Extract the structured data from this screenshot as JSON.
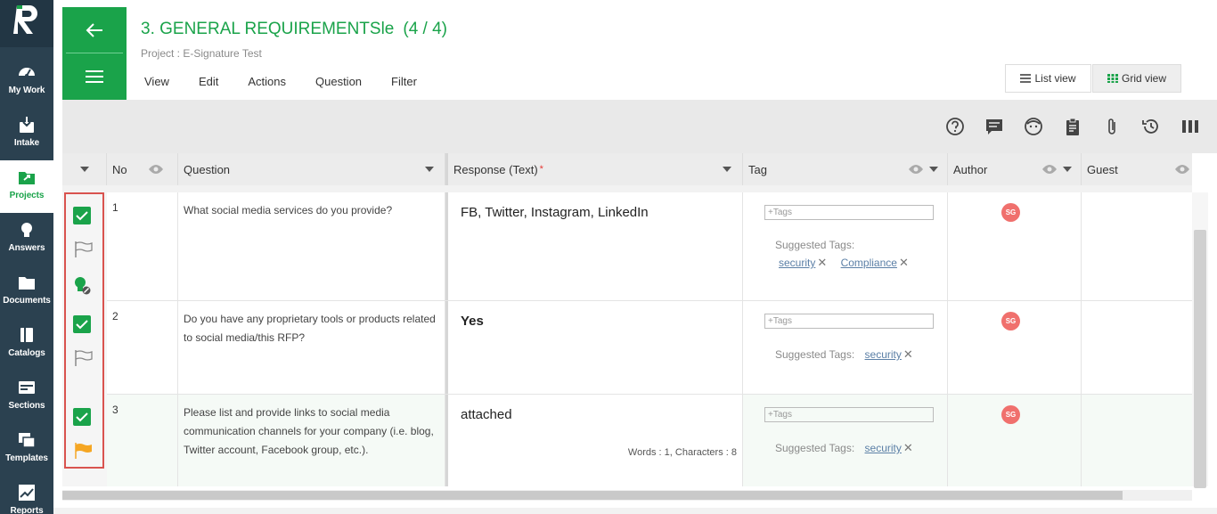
{
  "nav": {
    "items": [
      {
        "label": "My Work",
        "icon": "gauge-icon"
      },
      {
        "label": "Intake",
        "icon": "inbox-download-icon"
      },
      {
        "label": "Projects",
        "icon": "folder-arrow-icon",
        "active": true
      },
      {
        "label": "Answers",
        "icon": "lightbulb-icon"
      },
      {
        "label": "Documents",
        "icon": "folder-icon"
      },
      {
        "label": "Catalogs",
        "icon": "book-icon"
      },
      {
        "label": "Sections",
        "icon": "sections-icon"
      },
      {
        "label": "Templates",
        "icon": "templates-icon"
      },
      {
        "label": "Reports",
        "icon": "chart-icon"
      }
    ]
  },
  "header": {
    "title": "3. GENERAL REQUIREMENTSle",
    "count": "(4 / 4)",
    "project": "Project : E-Signature Test",
    "menu": [
      "View",
      "Edit",
      "Actions",
      "Question",
      "Filter"
    ],
    "list_view": "List view",
    "grid_view": "Grid view"
  },
  "toolbar": {
    "icons": [
      "help-icon",
      "comment-icon",
      "face-icon",
      "clipboard-icon",
      "attachment-icon",
      "history-icon",
      "columns-icon"
    ]
  },
  "table": {
    "headers": {
      "no": "No",
      "question": "Question",
      "response": "Response (Text)",
      "required_mark": "*",
      "tag": "Tag",
      "author": "Author",
      "guest": "Guest"
    },
    "tags_placeholder": "+Tags",
    "suggested_label": "Suggested Tags:",
    "rows": [
      {
        "no": "1",
        "question": "What social media services do you provide?",
        "response": "FB, Twitter, Instagram, LinkedIn",
        "tags": [
          "security",
          "Compliance"
        ],
        "author": "SG"
      },
      {
        "no": "2",
        "question": "Do you have any proprietary tools or products related to social media/this RFP?",
        "response": "Yes",
        "tags": [
          "security"
        ],
        "author": "SG"
      },
      {
        "no": "3",
        "question": "Please list and provide links to social media communication channels for your company (i.e. blog, Twitter account, Facebook group, etc.).",
        "response": "attached",
        "word_count": "Words : 1, Characters : 8",
        "tags": [
          "security"
        ],
        "author": "SG"
      }
    ]
  },
  "colors": {
    "brand_green": "#1aa34a",
    "nav_bg": "#2b4150",
    "flag_orange": "#f5a623",
    "avatar_red": "#f0706d",
    "highlight_red": "#d9534f"
  }
}
